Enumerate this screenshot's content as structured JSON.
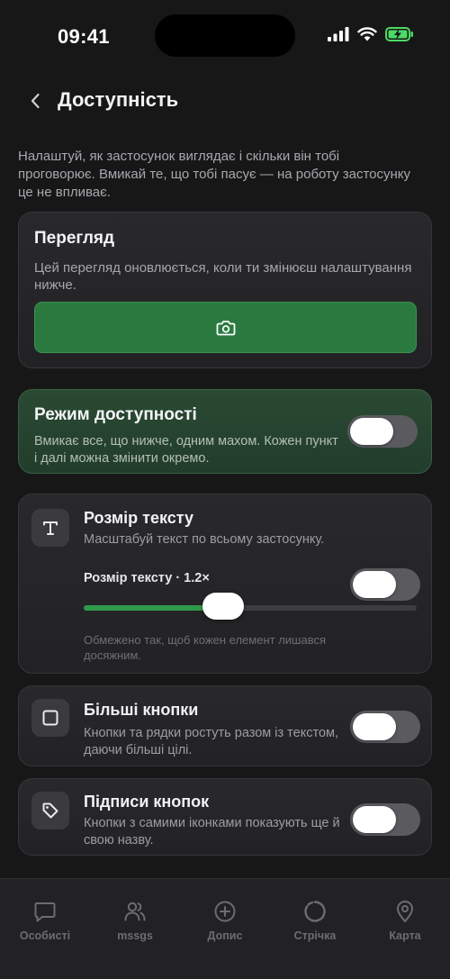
{
  "status": {
    "time": "09:41"
  },
  "header": {
    "title": "Доступність"
  },
  "intro": "Налаштуй, як застосунок виглядає і скільки він тобі проговорює. Вмикай те, що тобі пасує — на роботу застосунку це не впливає.",
  "preview": {
    "title": "Перегляд",
    "description": "Цей перегляд оновлюється, коли ти змінюєш налаштування нижче."
  },
  "accessibility_mode": {
    "title": "Режим доступності",
    "description": "Вмикає все, що нижче, одним махом. Кожен пункт і далі можна змінити окремо.",
    "enabled": false
  },
  "text_size": {
    "title": "Розмір тексту",
    "description": "Масштабуй текст по всьому застосунку.",
    "slider_label": "Розмір тексту · 1.2×",
    "value": 1.2,
    "fill_fraction": 0.42,
    "note": "Обмежено так, щоб кожен елемент лишався досяжним.",
    "enabled": false
  },
  "bigger_buttons": {
    "title": "Більші кнопки",
    "description": "Кнопки та рядки ростуть разом із текстом, даючи більші цілі.",
    "enabled": false
  },
  "button_labels": {
    "title": "Підписи кнопок",
    "description": "Кнопки з самими іконками показують ще й свою назву.",
    "enabled": false
  },
  "tabbar": {
    "items": [
      {
        "label": "Особисті",
        "icon": "chat-bubble-icon"
      },
      {
        "label": "mssgs",
        "icon": "people-icon"
      },
      {
        "label": "Допис",
        "icon": "plus-circle-icon"
      },
      {
        "label": "Стрічка",
        "icon": "circle-icon"
      },
      {
        "label": "Карта",
        "icon": "map-pin-icon"
      }
    ]
  },
  "colors": {
    "accent_green": "#2a7a3f",
    "background": "#171718",
    "battery": "#4cd964"
  }
}
